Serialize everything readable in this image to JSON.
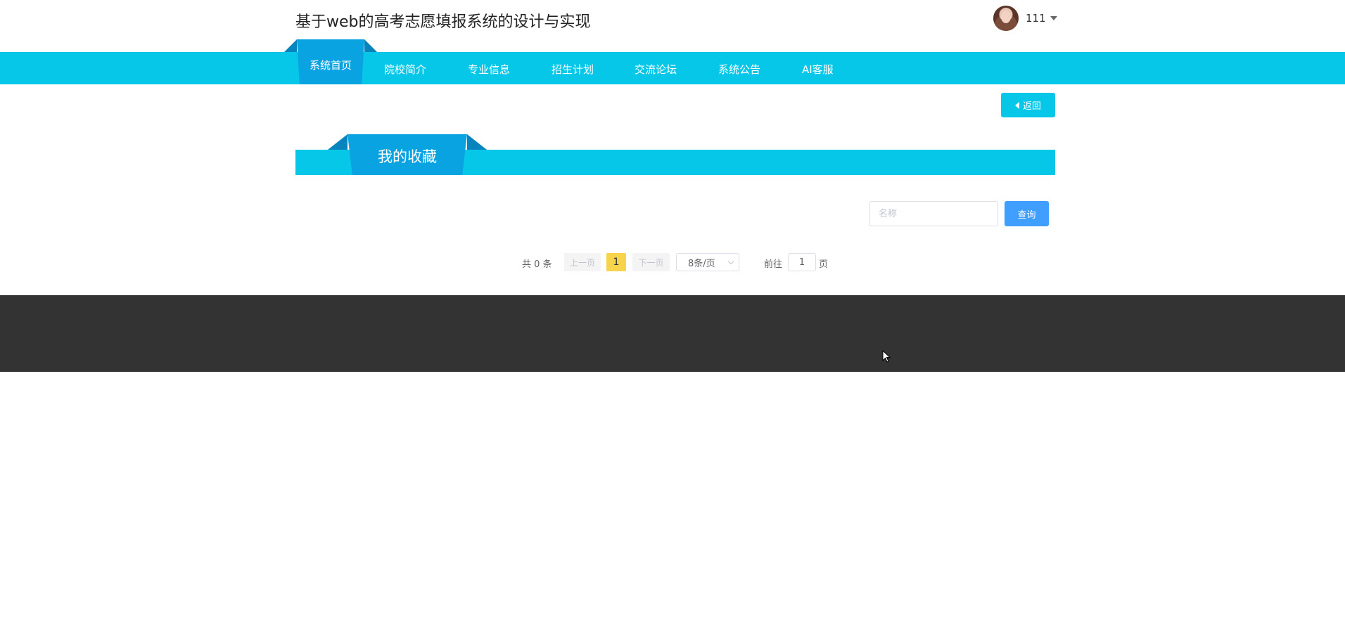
{
  "header": {
    "site_title": "基于web的高考志愿填报系统的设计与实现",
    "username": "111"
  },
  "nav": {
    "items": [
      {
        "label": "系统首页",
        "active": true
      },
      {
        "label": "院校简介"
      },
      {
        "label": "专业信息"
      },
      {
        "label": "招生计划"
      },
      {
        "label": "交流论坛"
      },
      {
        "label": "系统公告"
      },
      {
        "label": "AI客服"
      }
    ]
  },
  "actions": {
    "back_label": "返回"
  },
  "section": {
    "title": "我的收藏"
  },
  "search": {
    "placeholder": "名称",
    "value": "",
    "button_label": "查询"
  },
  "pagination": {
    "total_text": "共 0 条",
    "prev_label": "上一页",
    "next_label": "下一页",
    "current_page": "1",
    "page_size_label": "8条/页",
    "goto_label": "前往",
    "goto_value": "1",
    "goto_suffix": "页"
  },
  "colors": {
    "accent": "#07c7e8",
    "tab_active": "#0aa3e2",
    "tab_shadow": "#0784bd",
    "search_button": "#409eff",
    "current_page_bg": "#f7d44c",
    "footer_bg": "#333333"
  }
}
